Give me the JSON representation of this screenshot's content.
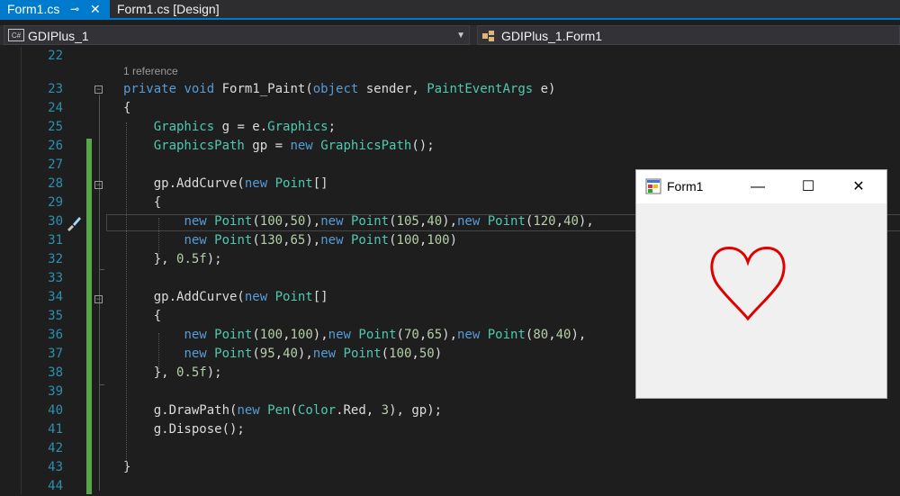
{
  "tabs": [
    {
      "label": "Form1.cs",
      "pin": "⊸"
    },
    {
      "label": "Form1.cs [Design]"
    }
  ],
  "navbar": {
    "project_icon": "C#",
    "project": "GDIPlus_1",
    "class": "GDIPlus_1.Form1"
  },
  "editor": {
    "reference": "1 reference",
    "lines": [
      {
        "n": "22",
        "code": ""
      },
      {
        "n": "23",
        "code": "private void Form1_Paint(object sender, PaintEventArgs e)"
      },
      {
        "n": "24",
        "code": "{"
      },
      {
        "n": "25",
        "code": "    Graphics g = e.Graphics;"
      },
      {
        "n": "26",
        "code": "    GraphicsPath gp = new GraphicsPath();"
      },
      {
        "n": "27",
        "code": ""
      },
      {
        "n": "28",
        "code": "    gp.AddCurve(new Point[]"
      },
      {
        "n": "29",
        "code": "    {"
      },
      {
        "n": "30",
        "code": "        new Point(100,50),new Point(105,40),new Point(120,40),"
      },
      {
        "n": "31",
        "code": "        new Point(130,65),new Point(100,100)"
      },
      {
        "n": "32",
        "code": "    }, 0.5f);"
      },
      {
        "n": "33",
        "code": ""
      },
      {
        "n": "34",
        "code": "    gp.AddCurve(new Point[]"
      },
      {
        "n": "35",
        "code": "    {"
      },
      {
        "n": "36",
        "code": "        new Point(100,100),new Point(70,65),new Point(80,40),"
      },
      {
        "n": "37",
        "code": "        new Point(95,40),new Point(100,50)"
      },
      {
        "n": "38",
        "code": "    }, 0.5f);"
      },
      {
        "n": "39",
        "code": ""
      },
      {
        "n": "40",
        "code": "    g.DrawPath(new Pen(Color.Red, 3), gp);"
      },
      {
        "n": "41",
        "code": "    g.Dispose();"
      },
      {
        "n": "42",
        "code": ""
      },
      {
        "n": "43",
        "code": "}"
      },
      {
        "n": "44",
        "code": ""
      }
    ]
  },
  "form": {
    "title": "Form1",
    "minimize": "—",
    "maximize": "☐",
    "close": "✕",
    "heart_color": "#e00000"
  },
  "colors": {
    "accent": "#007acc",
    "keyword": "#569cd6",
    "type": "#4ec9b0",
    "number": "#b5cea8",
    "line_number": "#2b91af",
    "change_bar": "#57a64a"
  }
}
